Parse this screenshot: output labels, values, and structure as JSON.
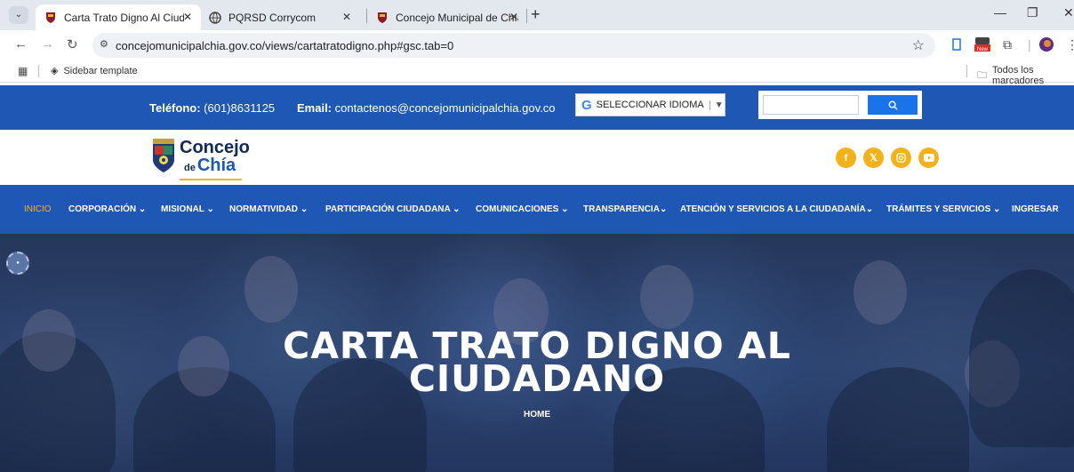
{
  "browser": {
    "tabs": [
      {
        "title": "Carta Trato Digno Al Ciudadano",
        "active": true
      },
      {
        "title": "PQRSD Corrycom",
        "active": false
      },
      {
        "title": "Concejo Municipal de Chía",
        "active": false
      }
    ],
    "url": "concejomunicipalchia.gov.co/views/cartatratodigno.php#gsc.tab=0",
    "bookmarks": {
      "sidebar_template": "Sidebar template",
      "all_bookmarks": "Todos los marcadores"
    },
    "new_badge": "New"
  },
  "topbar": {
    "phone_label": "Teléfono:",
    "phone_value": "(601)8631125",
    "email_label": "Email:",
    "email_value": "contactenos@concejomunicipalchia.gov.co",
    "language_select": "SELECCIONAR IDIOMA",
    "search_placeholder": ""
  },
  "logo": {
    "line1": "Concejo",
    "de": "de",
    "line2": "Chía"
  },
  "social": [
    "facebook-icon",
    "x-icon",
    "instagram-icon",
    "youtube-icon"
  ],
  "nav": {
    "inicio": "INICIO",
    "corporacion": "CORPORACIÓN",
    "misional": "MISIONAL",
    "normatividad": "NORMATIVIDAD",
    "participacion": "PARTICIPACIÓN CIUDADANA",
    "comunicaciones": "COMUNICACIONES",
    "transparencia": "TRANSPARENCIA",
    "atencion": "ATENCIÓN Y SERVICIOS A LA CIUDADANÍA",
    "tramites": "TRÁMITES Y SERVICIOS",
    "ingresar": "INGRESAR"
  },
  "hero": {
    "title_line1": "CARTA TRATO DIGNO AL",
    "title_line2": "CIUDADANO",
    "breadcrumb": "HOME"
  },
  "colors": {
    "brand_blue": "#1f57b4",
    "accent_yellow": "#f3b51d"
  }
}
